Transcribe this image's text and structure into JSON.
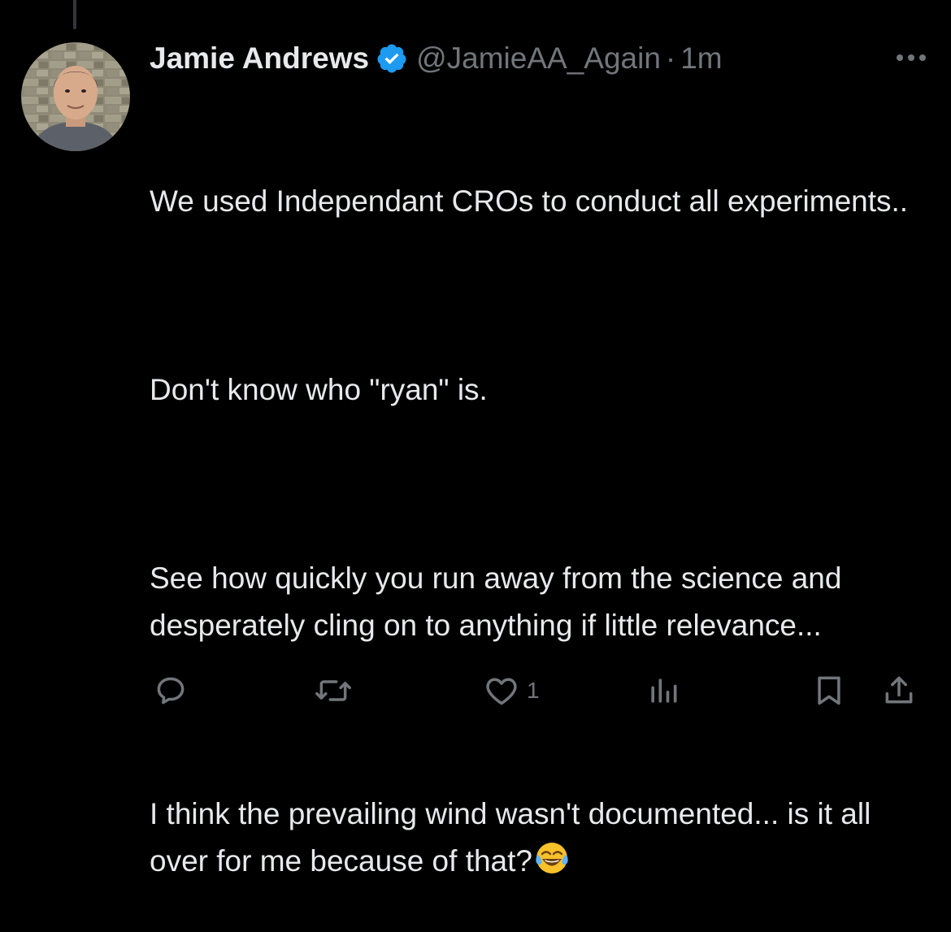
{
  "tweet": {
    "author": {
      "display_name": "Jamie Andrews",
      "handle": "@JamieAA_Again",
      "verified": true
    },
    "separator": "·",
    "time_ago": "1m",
    "paragraphs": [
      "We used Independant CROs to conduct all experiments..",
      "Don't know who \"ryan\" is.",
      "See how quickly you run away from the science and desperately cling on to anything if little relevance...",
      "I think the prevailing wind wasn't documented... is it all over for me because of that?"
    ],
    "trailing_emoji": "face-with-tears-of-joy"
  },
  "actions": {
    "reply_count": "",
    "retweet_count": "",
    "like_count": "1",
    "view_count": ""
  },
  "colors": {
    "background": "#000000",
    "text_primary": "#e7e9ea",
    "text_secondary": "#71767b",
    "verified_blue": "#1d9bf0",
    "thread_line": "#333639"
  }
}
